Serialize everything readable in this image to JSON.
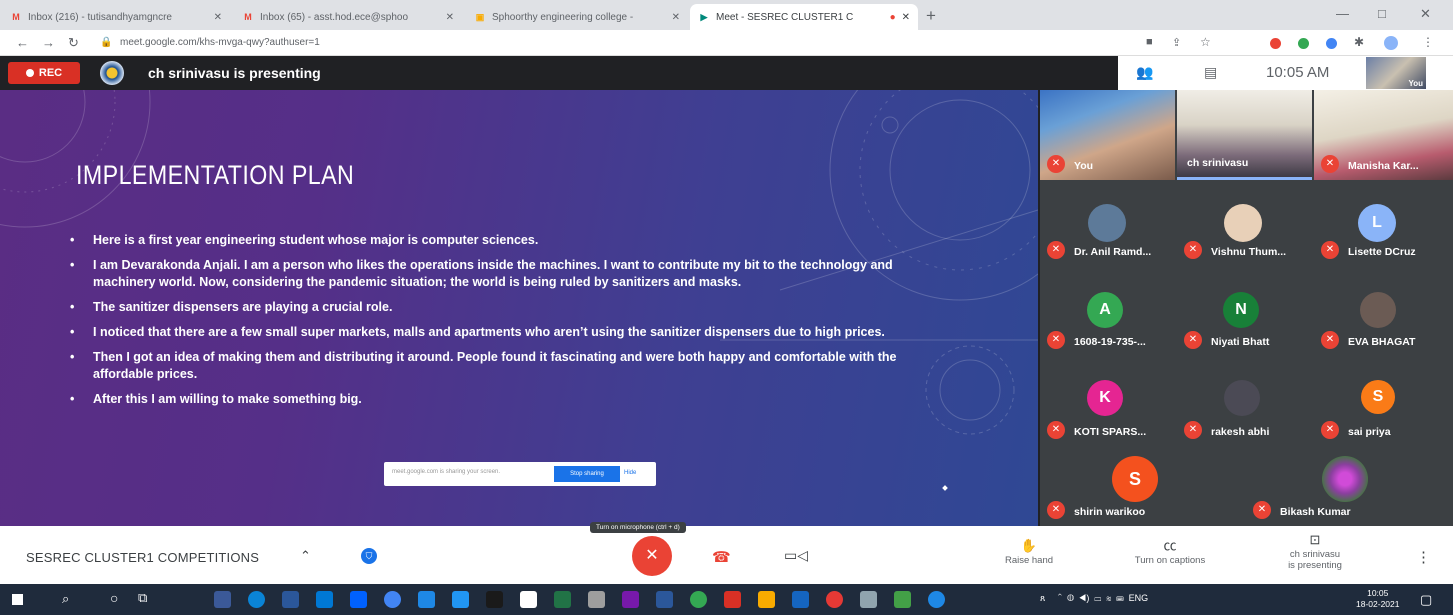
{
  "browser": {
    "tabs": [
      {
        "label": "Inbox (216) - tutisandhyamgncre",
        "icon": "gmail-icon",
        "active": false
      },
      {
        "label": "Inbox (65) - asst.hod.ece@sphoo",
        "icon": "gmail-icon",
        "active": false
      },
      {
        "label": "Sphoorthy engineering college -",
        "icon": "classroom-icon",
        "active": false
      },
      {
        "label": "Meet - SESREC CLUSTER1 C",
        "icon": "meet-icon",
        "active": true
      }
    ],
    "new_tab": "+",
    "window_controls": {
      "minimize": "—",
      "maximize": "□",
      "close": "✕"
    },
    "url": "meet.google.com/khs-mvga-qwy?authuser=1"
  },
  "meet_header": {
    "rec_label": "REC",
    "presenting_text": "ch srinivasu is presenting",
    "clock": "10:05 AM",
    "self_label": "You"
  },
  "slide": {
    "title": "IMPLEMENTATION PLAN",
    "bullets": [
      "Here is a first year engineering student whose major is computer sciences.",
      "I am Devarakonda Anjali. I am a person who likes the operations inside the machines. I want to contribute my bit to the technology and machinery world. Now, considering the pandemic situation; the world is being ruled by  sanitizers and masks.",
      "The sanitizer dispensers are playing a crucial role.",
      "I noticed that there are a few small super markets, malls and apartments who aren’t using the sanitizer dispensers due to high prices.",
      "Then I got an idea of making them and distributing it around. People found it fascinating and were both happy and comfortable with the affordable prices.",
      "After this I am willing to make something big."
    ],
    "share_notice": "meet.google.com is sharing your screen.",
    "stop_sharing": "Stop sharing",
    "hide": "Hide"
  },
  "participants": [
    {
      "name": "You",
      "initial": "",
      "color": ""
    },
    {
      "name": "ch srinivasu",
      "initial": "",
      "color": ""
    },
    {
      "name": "Manisha Kar...",
      "initial": "",
      "color": ""
    },
    {
      "name": "Dr. Anil Ramd...",
      "initial": "",
      "color": "#5d7a99"
    },
    {
      "name": "Vishnu Thum...",
      "initial": "",
      "color": "#e8d0b8"
    },
    {
      "name": "Lisette DCruz",
      "initial": "L",
      "color": "#8ab4f8"
    },
    {
      "name": "1608-19-735-...",
      "initial": "A",
      "color": "#34a853"
    },
    {
      "name": "Niyati Bhatt",
      "initial": "N",
      "color": "#188038"
    },
    {
      "name": "EVA BHAGAT",
      "initial": "",
      "color": "#6b5b54"
    },
    {
      "name": "KOTI SPARS...",
      "initial": "K",
      "color": "#e52592"
    },
    {
      "name": "rakesh abhi",
      "initial": "",
      "color": "#4b4a55"
    },
    {
      "name": "sai priya",
      "initial": "S",
      "color": "#fa7b17"
    },
    {
      "name": "shirin warikoo",
      "initial": "S",
      "color": "#f4511e"
    },
    {
      "name": "Bikash Kumar",
      "initial": "",
      "color": "#8a3f9e"
    }
  ],
  "bottom_bar": {
    "meeting_name": "SESREC CLUSTER1 COMPETITIONS",
    "tooltip": "Turn on microphone (ctrl + d)",
    "raise_hand": "Raise hand",
    "captions": "Turn on captions",
    "presenting_line1": "ch srinivasu",
    "presenting_line2": "is presenting"
  },
  "taskbar": {
    "lang": "ENG",
    "time": "10:05",
    "date": "18-02-2021"
  }
}
